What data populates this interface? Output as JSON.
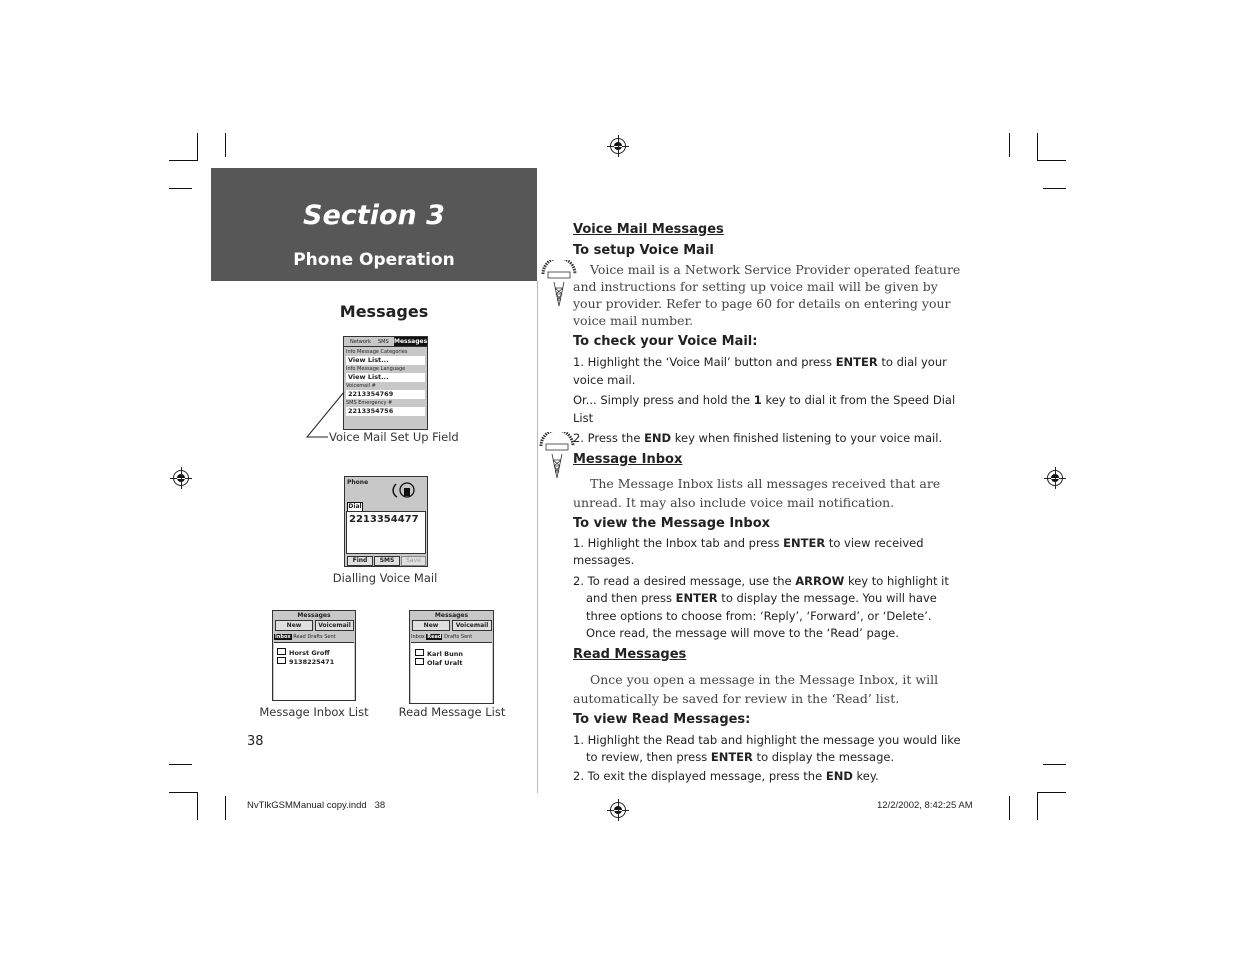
{
  "header": {
    "section_title": "Section 3",
    "section_subtitle": "Phone Operation"
  },
  "left": {
    "heading": "Messages",
    "voicemail_setup_screen": {
      "tabs": [
        "Network",
        "SMS",
        "Messages"
      ],
      "active_tab": "Messages",
      "rows": [
        {
          "label": "Info Message Categories",
          "value": "View List..."
        },
        {
          "label": "Info Message Language",
          "value": "View List..."
        },
        {
          "label": "Voicemail #",
          "value": "2213354769"
        },
        {
          "label": "SMS Emergency #",
          "value": "2213354756"
        }
      ],
      "callout": "Voice Mail Set Up Field"
    },
    "dialling_screen": {
      "title": "Phone",
      "tab": "Dial",
      "number": "2213354477",
      "buttons": [
        "Find",
        "SMS",
        "Save"
      ],
      "caption": "Dialling Voice Mail"
    },
    "inbox_screen": {
      "title": "Messages",
      "buttons": [
        "New",
        "Voicemail"
      ],
      "tabs": [
        "Inbox",
        "Read",
        "Drafts",
        "Sent"
      ],
      "active_tab": "Inbox",
      "items": [
        "Horst Groff",
        "9138225471"
      ],
      "caption": "Message Inbox List"
    },
    "read_screen": {
      "title": "Messages",
      "buttons": [
        "New",
        "Voicemail"
      ],
      "tabs": [
        "Inbox",
        "Read",
        "Drafts",
        "Sent"
      ],
      "active_tab": "Read",
      "items": [
        "Karl Bunn",
        "Olaf Uralt"
      ],
      "caption": "Read Message List"
    },
    "page_number": "38"
  },
  "right": {
    "voice_mail_heading": "Voice Mail Messages",
    "setup_heading": "To setup Voice Mail",
    "setup_icon": "network-subscription-dependent-feature-icon",
    "setup_body": "Voice mail is a Network Service Provider operated feature and instructions for setting up voice mail will be given by your provider. Refer to page 60 for details on entering your voice mail number.",
    "check_heading": "To check your Voice Mail:",
    "check_step1_pre": "1. Highlight the ‘Voice Mail’ button and press ",
    "check_step1_key": "ENTER",
    "check_step1_post": " to dial your voice mail.",
    "check_or_pre": "Or... Simply press and hold the ",
    "check_or_key": "1",
    "check_or_post": " key to dial it from the Speed Dial List",
    "check_step2_pre": "2. Press the ",
    "check_step2_key": "END",
    "check_step2_post": " key when finished listening to your voice mail.",
    "inbox_heading": "Message Inbox",
    "inbox_body": "The Message Inbox lists all messages received that are unread. It may also include voice mail notification.",
    "view_inbox_heading": "To view the Message Inbox",
    "view_inbox_step1_pre": "1. Highlight the Inbox tab and press ",
    "view_inbox_step1_key": "ENTER",
    "view_inbox_step1_post": " to view received messages.",
    "view_inbox_step2_a": "2. To read a desired message, use the ",
    "view_inbox_step2_key1": "ARROW",
    "view_inbox_step2_b": " key to highlight it and then press ",
    "view_inbox_step2_key2": "ENTER",
    "view_inbox_step2_c": " to display the message.  You will have three options to choose from: ‘Reply’, ‘Forward’, or ‘Delete’. Once read, the message will move to the ‘Read’ page.",
    "read_heading": "Read Messages",
    "read_body": "Once you open a message in the Message Inbox, it will automatically be saved for review in the ‘Read’ list.",
    "view_read_heading": "To view Read Messages:",
    "view_read_step1_pre": "1. Highlight the Read tab and highlight the message you would like to review, then press ",
    "view_read_step1_key": "ENTER",
    "view_read_step1_post": " to display the message.",
    "view_read_step2_pre": "2. To exit the displayed message, press the ",
    "view_read_step2_key": "END",
    "view_read_step2_post": " key."
  },
  "footer": {
    "file_info": "NvTlkGSMManual copy.indd   38",
    "timestamp": "12/2/2002, 8:42:25 AM"
  }
}
